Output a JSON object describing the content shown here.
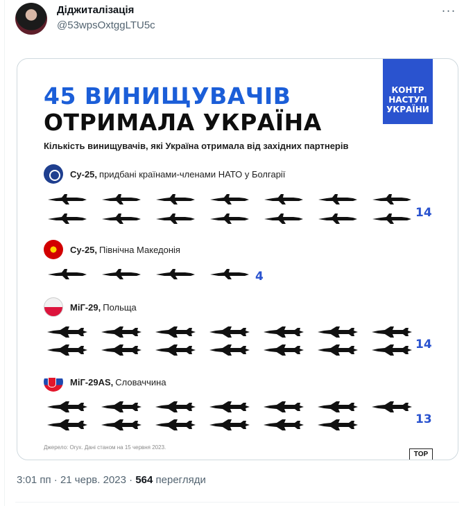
{
  "author": {
    "display_name": "Діджиталізація",
    "handle": "@53wpsOxtggLTU5c",
    "more_label": "···"
  },
  "infographic": {
    "title_line1": "45 ВИНИЩУВАЧІВ",
    "title_line2": "ОТРИМАЛА УКРАЇНА",
    "badge_lines": [
      "КОНТР",
      "НАСТУП",
      "УКРАЇНИ"
    ],
    "subtitle": "Кількість винищувачів, які Україна отримала від західних партнерів",
    "sections": [
      {
        "aircraft": "Су-25,",
        "source_text": "придбані країнами-членами НАТО у Болгарії",
        "count": "14",
        "flag_icon": "nato-flag-icon",
        "count_value": 14
      },
      {
        "aircraft": "Су-25,",
        "source_text": "Північна Македонія",
        "count": "4",
        "flag_icon": "north-macedonia-flag-icon",
        "count_value": 4
      },
      {
        "aircraft": "МіГ-29,",
        "source_text": "Польща",
        "count": "14",
        "flag_icon": "poland-flag-icon",
        "count_value": 14
      },
      {
        "aircraft": "МіГ-29AS,",
        "source_text": "Словаччина",
        "count": "13",
        "flag_icon": "slovakia-flag-icon",
        "count_value": 13
      }
    ],
    "source_note": "Джерело: Oryx. Дані станом на 15 червня 2023.",
    "logo_text": "TOP"
  },
  "meta": {
    "time": "3:01 пп",
    "separator": " · ",
    "date": "21 черв. 2023",
    "views_count": "564",
    "views_label": " перегляди"
  },
  "colors": {
    "accent": "#2a53cf",
    "title_blue": "#1b5ed8",
    "plane": "#111111"
  }
}
